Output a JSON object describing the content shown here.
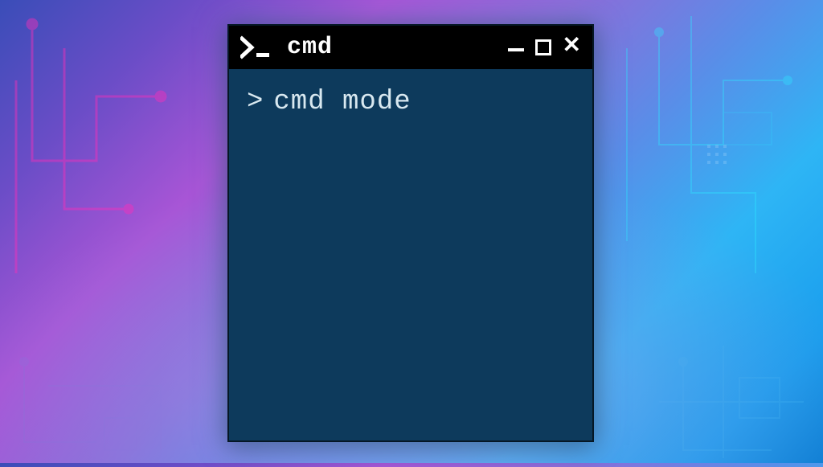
{
  "window": {
    "title": "cmd",
    "icon_glyph": ">_"
  },
  "terminal": {
    "prompt": ">",
    "command": "cmd mode"
  },
  "colors": {
    "terminal_bg": "#0d3a5c",
    "titlebar_bg": "#000000",
    "text": "#d8e8f0"
  }
}
